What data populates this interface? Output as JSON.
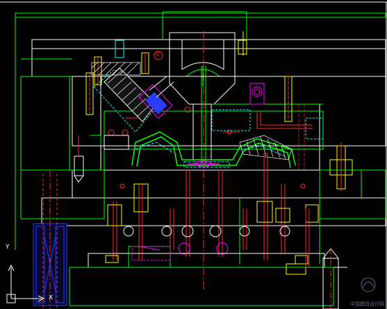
{
  "ucs": {
    "y_label": "Y",
    "x_label": "X"
  },
  "balloon": {
    "number": "①"
  },
  "watermark": {
    "text": "中国模具设计网"
  },
  "colors": {
    "background": "#000000",
    "frame": "#ffffff",
    "outline": "#00ff00",
    "hidden": "#00ffff",
    "red": "#ff2a2a",
    "yellow": "#ffff00",
    "magenta": "#ff00ff",
    "blue": "#2a3cff",
    "white": "#ffffff"
  },
  "icons": [
    "ucs-axis-icon",
    "balloon-icon",
    "watermark-logo-icon"
  ]
}
